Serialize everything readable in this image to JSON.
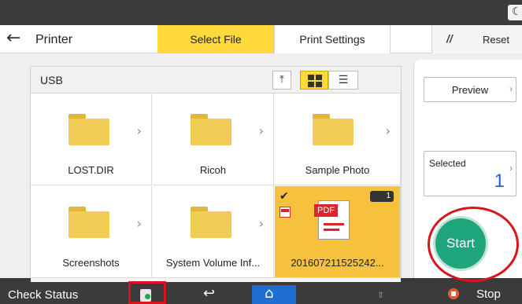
{
  "header": {
    "title": "Printer",
    "tabs": [
      {
        "label": "Select File",
        "active": true
      },
      {
        "label": "Print Settings",
        "active": false
      }
    ],
    "reset_label": "Reset"
  },
  "browser": {
    "path": "USB",
    "view_mode": "grid",
    "items": [
      {
        "name": "LOST.DIR",
        "type": "folder"
      },
      {
        "name": "Ricoh",
        "type": "folder"
      },
      {
        "name": "Sample Photo",
        "type": "folder"
      },
      {
        "name": "Screenshots",
        "type": "folder"
      },
      {
        "name": "System Volume Inf...",
        "type": "folder"
      },
      {
        "name": "201607211525242...",
        "type": "pdf",
        "selected": true,
        "badge": "1",
        "icon_label": "PDF"
      }
    ]
  },
  "side": {
    "preview_label": "Preview",
    "selected_label": "Selected",
    "selected_count": "1",
    "start_label": "Start"
  },
  "status_bar": {
    "check_status": "Check Status",
    "stop_label": "Stop"
  },
  "colors": {
    "accent_yellow": "#ffd83a",
    "start_green": "#1ea57c",
    "home_blue": "#1e6fd1",
    "highlight_red": "#d9141b"
  }
}
